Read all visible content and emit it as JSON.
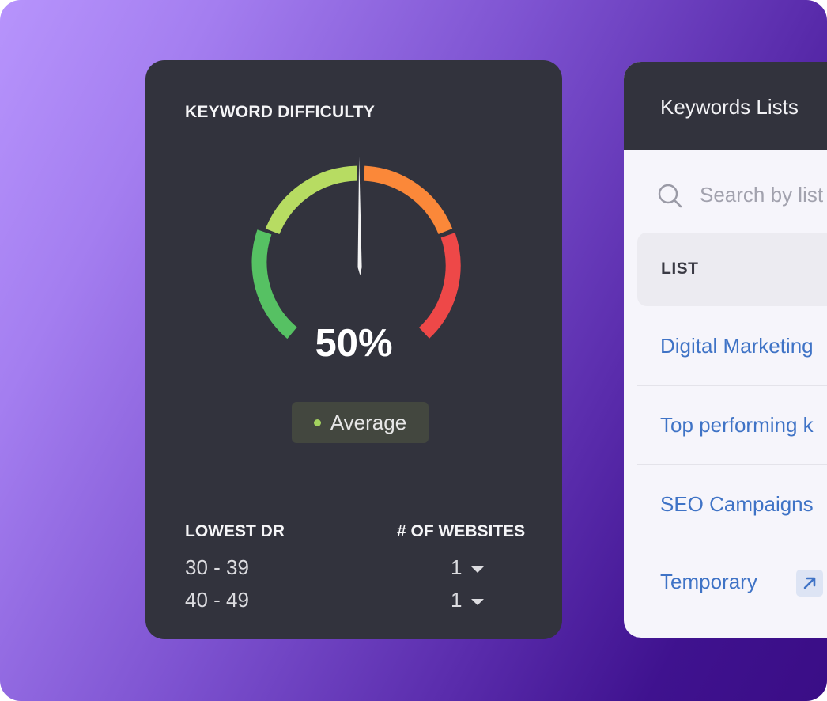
{
  "keyword_difficulty": {
    "title": "KEYWORD DIFFICULTY",
    "value": "50%",
    "level": 0.5,
    "badge": "Average",
    "colors": {
      "green": "#56c163",
      "light_green": "#b7dc62",
      "orange": "#fb8839",
      "red": "#ee4848",
      "badge_dot": "#a3d25e"
    },
    "columns": [
      "LOWEST DR",
      "# OF WEBSITES"
    ],
    "rows": [
      {
        "range": "30 - 39",
        "count": "1"
      },
      {
        "range": "40 - 49",
        "count": "1"
      }
    ]
  },
  "keywords_lists": {
    "title": "Keywords Lists",
    "search_placeholder": "Search by list",
    "column": "LIST",
    "items": [
      "Digital Marketing",
      "Top performing k",
      "SEO Campaigns",
      "Temporary"
    ],
    "link_color": "#3f73c6"
  }
}
